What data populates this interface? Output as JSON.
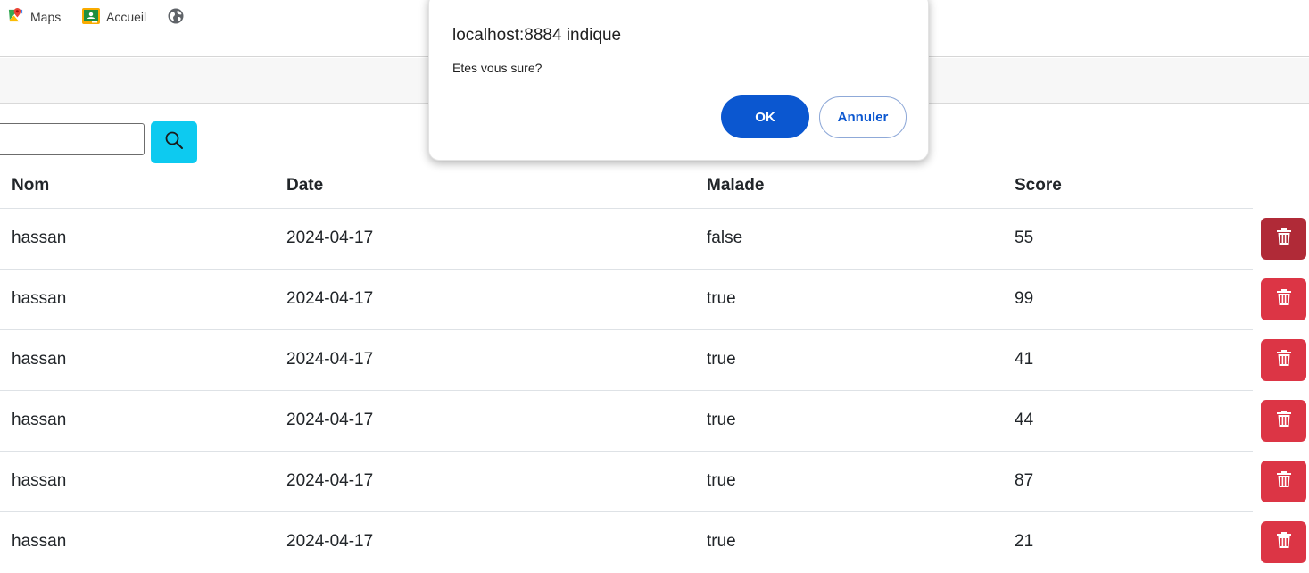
{
  "bookmarks": [
    {
      "label": "Maps",
      "icon": "maps-icon"
    },
    {
      "label": "Accueil",
      "icon": "classroom-icon"
    },
    {
      "label": "",
      "icon": "globe-icon"
    }
  ],
  "search": {
    "placeholder": "",
    "value": ""
  },
  "table": {
    "headers": [
      "Nom",
      "Date",
      "Malade",
      "Score"
    ],
    "rows": [
      {
        "nom": "hassan",
        "date": "2024-04-17",
        "malade": "false",
        "score": "55"
      },
      {
        "nom": "hassan",
        "date": "2024-04-17",
        "malade": "true",
        "score": "99"
      },
      {
        "nom": "hassan",
        "date": "2024-04-17",
        "malade": "true",
        "score": "41"
      },
      {
        "nom": "hassan",
        "date": "2024-04-17",
        "malade": "true",
        "score": "44"
      },
      {
        "nom": "hassan",
        "date": "2024-04-17",
        "malade": "true",
        "score": "87"
      },
      {
        "nom": "hassan",
        "date": "2024-04-17",
        "malade": "true",
        "score": "21"
      }
    ]
  },
  "dialog": {
    "title": "localhost:8884 indique",
    "message": "Etes vous sure?",
    "ok_label": "OK",
    "cancel_label": "Annuler"
  },
  "colors": {
    "accent_search": "#0dcaf0",
    "danger": "#dc3545",
    "danger_active": "#b02a37",
    "dialog_primary": "#0b57d0"
  }
}
